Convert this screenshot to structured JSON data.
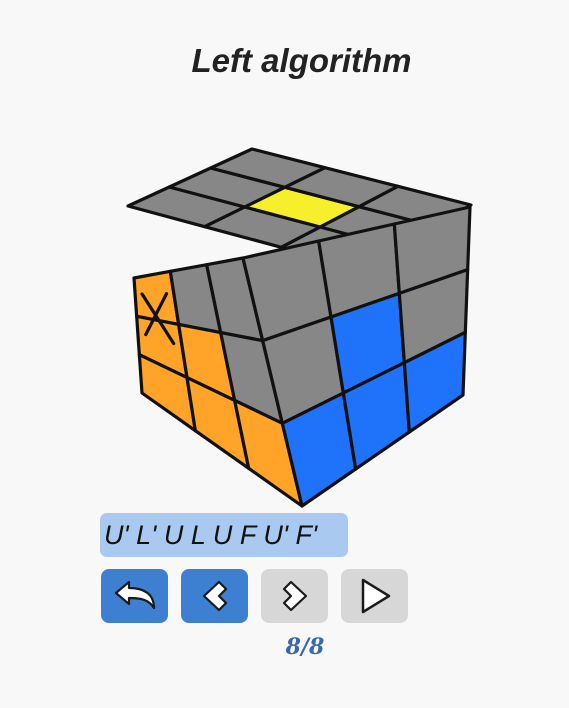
{
  "title": "Left algorithm",
  "algorithm": "U' L' U L U F U' F'",
  "progress": "8/8",
  "colors": {
    "gray": "#878787",
    "yellow": "#f7ef2a",
    "orange": "#ffa329",
    "blue": "#1f72fa",
    "algorithm_highlight": "#a9c9f0",
    "button_active": "#3d7fd0",
    "button_inactive": "#d7d7d7"
  },
  "cube": {
    "top_face": [
      [
        "gray",
        "gray",
        "gray"
      ],
      [
        "gray",
        "yellow",
        "gray"
      ],
      [
        "gray",
        "gray",
        "gray"
      ]
    ],
    "front_face": [
      [
        "orange",
        "gray",
        "gray"
      ],
      [
        "orange",
        "orange",
        "gray"
      ],
      [
        "orange",
        "orange",
        "orange"
      ]
    ],
    "right_face": [
      [
        "gray",
        "gray",
        "gray"
      ],
      [
        "gray",
        "blue",
        "gray"
      ],
      [
        "blue",
        "blue",
        "blue"
      ]
    ],
    "marked_sticker": "front-row1-col1"
  },
  "buttons": {
    "reset": {
      "icon": "undo-arrow-icon",
      "state": "active"
    },
    "previous": {
      "icon": "chevron-left-icon",
      "state": "active"
    },
    "next": {
      "icon": "chevron-right-icon",
      "state": "inactive"
    },
    "play": {
      "icon": "play-icon",
      "state": "inactive"
    }
  }
}
